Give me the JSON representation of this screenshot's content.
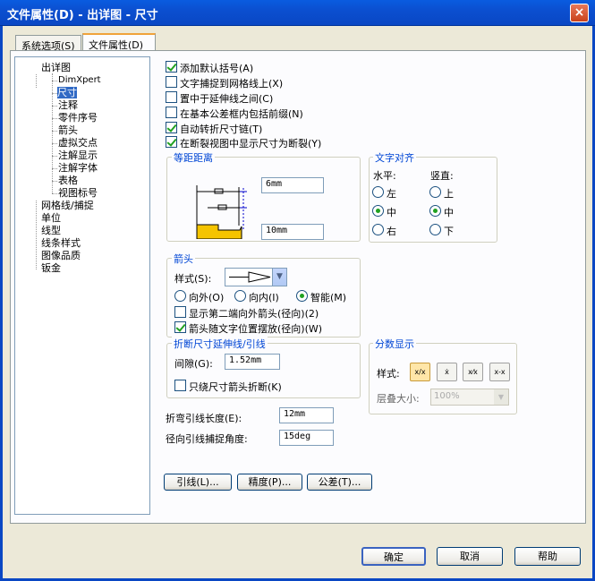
{
  "window": {
    "title": "文件属性(D) - 出详图 - 尺寸",
    "close_glyph": "×"
  },
  "tabs": [
    {
      "label": "系统选项(S)"
    },
    {
      "label": "文件属性(D)"
    }
  ],
  "tree": {
    "items": [
      {
        "label": "出详图"
      },
      {
        "label": "DimXpert"
      },
      {
        "label": "尺寸"
      },
      {
        "label": "注释"
      },
      {
        "label": "零件序号"
      },
      {
        "label": "箭头"
      },
      {
        "label": "虚拟交点"
      },
      {
        "label": "注解显示"
      },
      {
        "label": "注解字体"
      },
      {
        "label": "表格"
      },
      {
        "label": "视图标号"
      },
      {
        "label": "网格线/捕捉"
      },
      {
        "label": "单位"
      },
      {
        "label": "线型"
      },
      {
        "label": "线条样式"
      },
      {
        "label": "图像品质"
      },
      {
        "label": "钣金"
      }
    ]
  },
  "options": [
    {
      "label": "添加默认括号(A)",
      "checked": true
    },
    {
      "label": "文字捕捉到网格线上(X)",
      "checked": false
    },
    {
      "label": "置中于延伸线之间(C)",
      "checked": false
    },
    {
      "label": "在基本公差框内包括前缀(N)",
      "checked": false
    },
    {
      "label": "自动转折尺寸链(T)",
      "checked": true
    },
    {
      "label": "在断裂视图中显示尺寸为断裂(Y)",
      "checked": true
    }
  ],
  "offset": {
    "title": "等距距离",
    "value1": "6mm",
    "value2": "10mm"
  },
  "text_align": {
    "title": "文字对齐",
    "horizontal_label": "水平:",
    "vertical_label": "竖直:",
    "horizontal": [
      {
        "label": "左",
        "checked": false
      },
      {
        "label": "中",
        "checked": true
      },
      {
        "label": "右",
        "checked": false
      }
    ],
    "vertical": [
      {
        "label": "上",
        "checked": false
      },
      {
        "label": "中",
        "checked": true
      },
      {
        "label": "下",
        "checked": false
      }
    ]
  },
  "arrows": {
    "title": "箭头",
    "style_label": "样式(S):",
    "radios": [
      {
        "label": "向外(O)",
        "checked": false
      },
      {
        "label": "向内(I)",
        "checked": false
      },
      {
        "label": "智能(M)",
        "checked": true
      }
    ],
    "checks": [
      {
        "label": "显示第二端向外箭头(径向)(2)",
        "checked": false
      },
      {
        "label": "箭头随文字位置摆放(径向)(W)",
        "checked": true
      }
    ]
  },
  "break": {
    "title": "折断尺寸延伸线/引线",
    "gap_label": "间隙(G):",
    "gap_value": "1.52mm",
    "only_label": "只绕尺寸箭头折断(K)",
    "only_checked": false
  },
  "fraction": {
    "title": "分数显示",
    "style_label": "样式:",
    "stack_label": "层叠大小:",
    "stack_value": "100%",
    "styles": [
      "x/x",
      "x/x stacked",
      "x/x diagonal",
      "x-x/x"
    ]
  },
  "bent_leader": {
    "label": "折弯引线长度(E):",
    "value": "12mm"
  },
  "radial_snap": {
    "label": "径向引线捕捉角度:",
    "value": "15deg"
  },
  "sub_buttons": [
    {
      "label": "引线(L)..."
    },
    {
      "label": "精度(P)..."
    },
    {
      "label": "公差(T)..."
    }
  ],
  "footer": [
    {
      "label": "确定"
    },
    {
      "label": "取消"
    },
    {
      "label": "帮助"
    }
  ]
}
